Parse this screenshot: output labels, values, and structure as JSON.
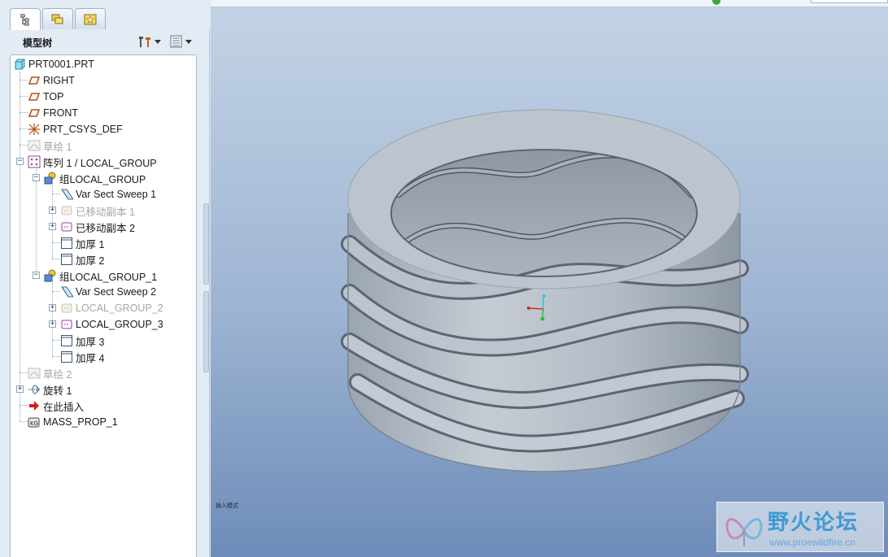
{
  "panel": {
    "title": "模型树",
    "tabs": [
      "model-tree",
      "layers",
      "favorites"
    ]
  },
  "tree": {
    "items": [
      {
        "label": "PRT0001.PRT",
        "icon": "part-icon",
        "disabled": false
      },
      {
        "label": "RIGHT",
        "icon": "datum-plane-icon",
        "disabled": false
      },
      {
        "label": "TOP",
        "icon": "datum-plane-icon",
        "disabled": false
      },
      {
        "label": "FRONT",
        "icon": "datum-plane-icon",
        "disabled": false
      },
      {
        "label": "PRT_CSYS_DEF",
        "icon": "csys-icon",
        "disabled": false
      },
      {
        "label": "草绘 1",
        "icon": "sketch-icon",
        "disabled": true
      },
      {
        "label": "阵列 1 / LOCAL_GROUP",
        "icon": "pattern-icon",
        "disabled": false
      },
      {
        "label": "组LOCAL_GROUP",
        "icon": "group-icon",
        "disabled": false
      },
      {
        "label": "Var Sect Sweep 1",
        "icon": "sweep-icon",
        "disabled": false
      },
      {
        "label": "已移动副本 1",
        "icon": "moved-copy-icon",
        "disabled": true
      },
      {
        "label": "已移动副本 2",
        "icon": "moved-copy-icon",
        "disabled": false
      },
      {
        "label": "加厚 1",
        "icon": "thicken-icon",
        "disabled": false
      },
      {
        "label": "加厚 2",
        "icon": "thicken-icon",
        "disabled": false
      },
      {
        "label": "组LOCAL_GROUP_1",
        "icon": "group-icon",
        "disabled": false
      },
      {
        "label": "Var Sect Sweep 2",
        "icon": "sweep-icon",
        "disabled": false
      },
      {
        "label": "LOCAL_GROUP_2",
        "icon": "moved-copy-icon",
        "disabled": true
      },
      {
        "label": "LOCAL_GROUP_3",
        "icon": "moved-copy-icon",
        "disabled": false
      },
      {
        "label": "加厚 3",
        "icon": "thicken-icon",
        "disabled": false
      },
      {
        "label": "加厚 4",
        "icon": "thicken-icon",
        "disabled": false
      },
      {
        "label": "草绘 2",
        "icon": "sketch-icon",
        "disabled": true
      },
      {
        "label": "旋转 1",
        "icon": "revolve-icon",
        "disabled": false
      },
      {
        "label": "在此插入",
        "icon": "insert-here-icon",
        "disabled": false
      },
      {
        "label": "MASS_PROP_1",
        "icon": "analysis-icon",
        "disabled": false
      }
    ]
  },
  "viewport": {
    "hint": "插入模式",
    "colors": {
      "part": "#b7c0ca",
      "edge": "#5e6670",
      "bg_top": "#c3d3e6",
      "bg_bottom": "#6e8cb9"
    }
  },
  "watermark": {
    "title": "野火论坛",
    "url": "www.proewildfire.cn"
  }
}
